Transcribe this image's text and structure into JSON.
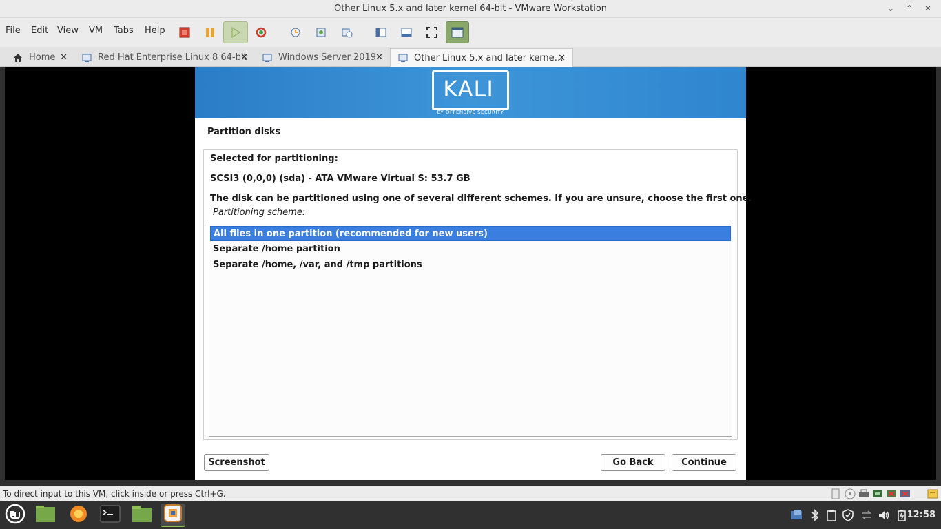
{
  "window": {
    "title": "Other Linux 5.x and later kernel 64-bit - VMware Workstation",
    "minimize_glyph": "⌄",
    "restore_glyph": "⌃",
    "close_glyph": "✕"
  },
  "menu": {
    "items": [
      "File",
      "Edit",
      "View",
      "VM",
      "Tabs",
      "Help"
    ]
  },
  "toolbar": {
    "buttons": [
      "power-off-icon",
      "suspend-icon",
      "play-icon",
      "restart-icon",
      "snapshot-icon",
      "revert-snapshot-icon",
      "snapshot-manager-icon",
      "library-icon",
      "thumbnail-bar-icon",
      "fullscreen-icon",
      "unity-icon"
    ]
  },
  "tabs": [
    {
      "label": "Home",
      "icon": "home-icon",
      "active": false
    },
    {
      "label": "Red Hat Enterprise Linux 8 64-bit",
      "icon": "vm-icon",
      "active": false
    },
    {
      "label": "Windows Server 2019",
      "icon": "vm-icon",
      "active": false
    },
    {
      "label": "Other Linux 5.x and later kerne…",
      "icon": "vm-icon",
      "active": true
    }
  ],
  "tab_close_glyph": "✕",
  "installer": {
    "logo_text": "KALI",
    "logo_subtext": "BY OFFENSIVE SECURITY",
    "heading": "Partition disks",
    "selected_label": "Selected for partitioning:",
    "disk": "SCSI3 (0,0,0) (sda) - ATA VMware Virtual S: 53.7 GB",
    "description": "The disk can be partitioned using one of several different schemes. If you are unsure, choose the first one.",
    "scheme_label": "Partitioning scheme:",
    "options": [
      "All files in one partition (recommended for new users)",
      "Separate /home partition",
      "Separate /home, /var, and /tmp partitions"
    ],
    "selected_option": 0,
    "buttons": {
      "screenshot": "Screenshot",
      "go_back": "Go Back",
      "continue": "Continue"
    }
  },
  "statusbar": {
    "text": "To direct input to this VM, click inside or press Ctrl+G.",
    "device_icons": [
      "hard-disk-icon",
      "cd-drive-icon",
      "printer-icon",
      "network-icon",
      "usb-icon",
      "sound-icon",
      "message-icon"
    ]
  },
  "taskbar": {
    "apps": [
      "mint-menu-icon",
      "files-icon",
      "firefox-icon",
      "terminal-icon",
      "folder-icon",
      "vmware-icon"
    ],
    "tray": [
      "vmware-tray-icon",
      "bluetooth-icon",
      "clipboard-icon",
      "shield-icon",
      "network-arrows-icon",
      "volume-icon",
      "battery-icon"
    ],
    "clock": "12:58"
  },
  "colors": {
    "banner": "#2f86cf",
    "selection": "#3a7fe0",
    "taskbar": "#303030",
    "mint_green": "#8fbe55"
  }
}
